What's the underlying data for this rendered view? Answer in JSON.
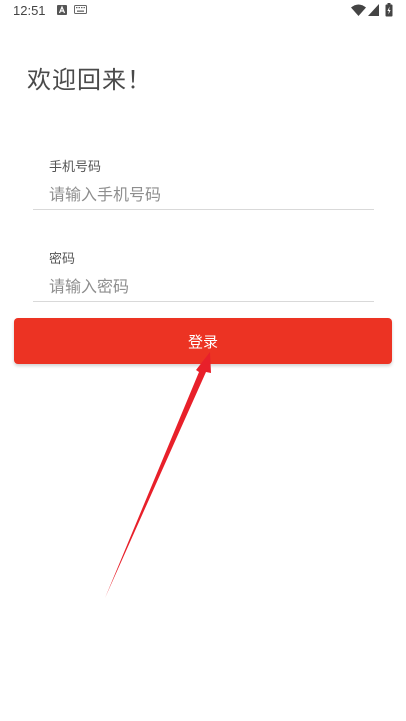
{
  "status_bar": {
    "time": "12:51",
    "icons": [
      "text-a-icon",
      "keyboard-icon",
      "wifi-icon",
      "signal-icon",
      "battery-charging-icon"
    ]
  },
  "welcome_title": "欢迎回来！",
  "form": {
    "phone": {
      "label": "手机号码",
      "placeholder": "请输入手机号码",
      "value": ""
    },
    "password": {
      "label": "密码",
      "placeholder": "请输入密码",
      "value": ""
    }
  },
  "login_button_label": "登录",
  "colors": {
    "accent": "#ec3323",
    "annotation_arrow": "#e8202a"
  }
}
